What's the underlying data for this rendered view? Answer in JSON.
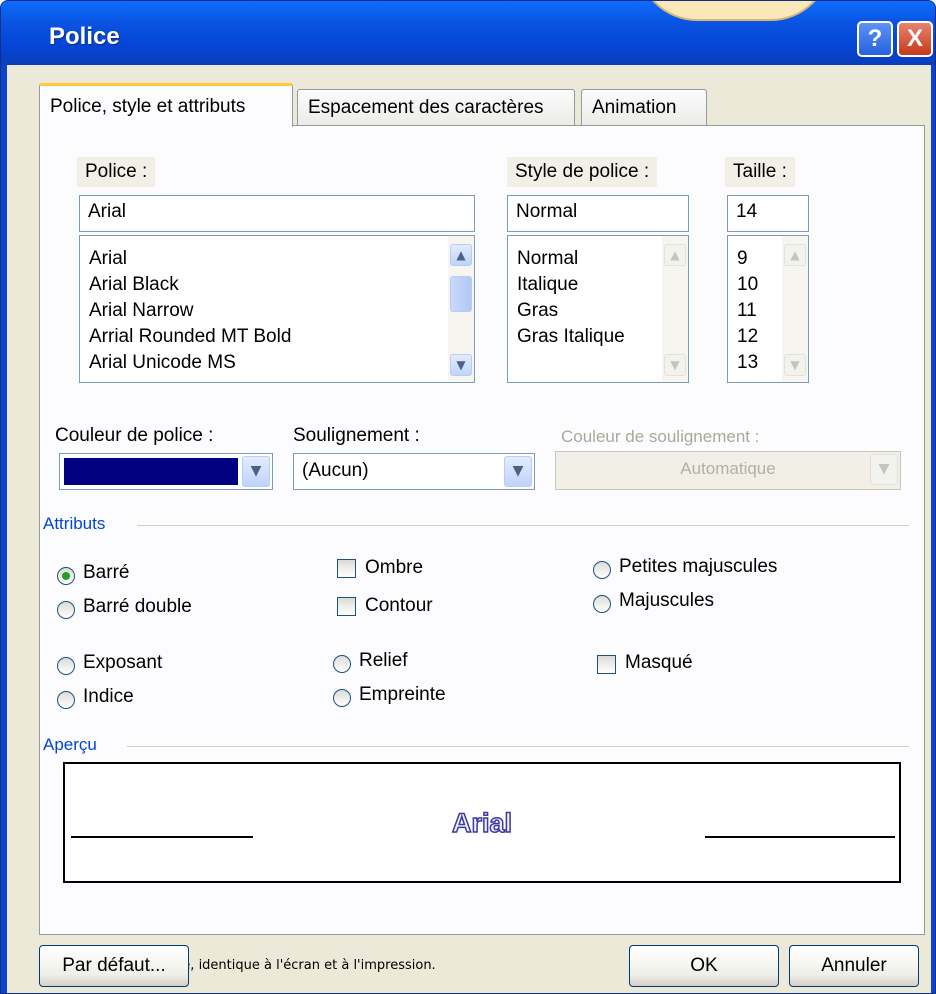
{
  "window": {
    "title": "Police",
    "help_label": "?",
    "close_label": "X"
  },
  "tabs": [
    {
      "label": "Police, style et attributs",
      "active": true
    },
    {
      "label": "Espacement des caractères",
      "active": false
    },
    {
      "label": "Animation",
      "active": false
    }
  ],
  "font": {
    "label": "Police :",
    "value": "Arial",
    "options": [
      "Arial",
      "Arial Black",
      "Arial Narrow",
      "Arrial Rounded MT Bold",
      "Arial Unicode MS"
    ]
  },
  "style": {
    "label": "Style de police :",
    "value": "Normal",
    "options": [
      "Normal",
      "Italique",
      "Gras",
      "Gras Italique"
    ]
  },
  "size": {
    "label": "Taille :",
    "value": "14",
    "options": [
      "9",
      "10",
      "11",
      "12",
      "13"
    ]
  },
  "font_color": {
    "label": "Couleur de police :",
    "color": "#000080"
  },
  "underline": {
    "label": "Soulignement :",
    "value": "(Aucun)"
  },
  "underline_color": {
    "label": "Couleur de soulignement :",
    "value": "Automatique",
    "enabled": false
  },
  "attributes": {
    "group_label": "Attributs",
    "options": {
      "barre": {
        "label": "Barré",
        "type": "radio",
        "checked": true
      },
      "barre_double": {
        "label": "Barré double",
        "type": "radio",
        "checked": false
      },
      "exposant": {
        "label": "Exposant",
        "type": "radio",
        "checked": false
      },
      "indice": {
        "label": "Indice",
        "type": "radio",
        "checked": false
      },
      "ombre": {
        "label": "Ombre",
        "type": "checkbox",
        "checked": false
      },
      "contour": {
        "label": "Contour",
        "type": "checkbox",
        "checked": false
      },
      "relief": {
        "label": "Relief",
        "type": "radio",
        "checked": false
      },
      "empreinte": {
        "label": "Empreinte",
        "type": "radio",
        "checked": false
      },
      "petites_majuscules": {
        "label": "Petites majuscules",
        "type": "radio",
        "checked": false
      },
      "majuscules": {
        "label": "Majuscules",
        "type": "radio",
        "checked": false
      },
      "masque": {
        "label": "Masqué",
        "type": "checkbox",
        "checked": false
      }
    }
  },
  "preview": {
    "group_label": "Aperçu",
    "text": "Arial",
    "note": "Police TrueType, identique à l'écran et à l'impression."
  },
  "buttons": {
    "default_label": "Par défaut...",
    "ok_label": "OK",
    "cancel_label": "Annuler"
  },
  "colors": {
    "title_bar": "#0a53e0",
    "dialog_face": "#ece9d8",
    "group_label": "#0046d5",
    "selected_tab_accent": "#ffc83c"
  }
}
